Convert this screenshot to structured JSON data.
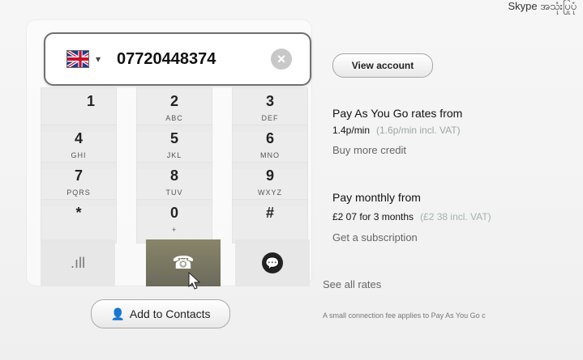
{
  "top_caption": "Skype အသုံးပြုပုံ",
  "dialer": {
    "country": "United Kingdom",
    "phone_number": "07720448374",
    "clear_label": "×",
    "keys": [
      {
        "num": "1",
        "sub": ""
      },
      {
        "num": "2",
        "sub": "ABC"
      },
      {
        "num": "3",
        "sub": "DEF"
      },
      {
        "num": "4",
        "sub": "GHI"
      },
      {
        "num": "5",
        "sub": "JKL"
      },
      {
        "num": "6",
        "sub": "MNO"
      },
      {
        "num": "7",
        "sub": "PQRS"
      },
      {
        "num": "8",
        "sub": "TUV"
      },
      {
        "num": "9",
        "sub": "WXYZ"
      },
      {
        "num": "*",
        "sub": ""
      },
      {
        "num": "0",
        "sub": "+"
      },
      {
        "num": "#",
        "sub": ""
      }
    ],
    "signal_label": ".ıll",
    "call_icon": "phone-icon",
    "chat_icon": "chat-icon",
    "add_to_contacts_label": "Add to Contacts"
  },
  "account": {
    "view_account_label": "View account",
    "payg_title": "Pay As You Go rates from",
    "payg_price": "1.4p/min",
    "payg_incl": "(1.6p/min incl. VAT)",
    "buy_more_credit": "Buy more credit",
    "monthly_title": "Pay monthly from",
    "monthly_price": "£2 07 for 3 months",
    "monthly_incl": "(£2 38 incl. VAT)",
    "get_subscription": "Get a subscription",
    "see_all_rates": "See all rates",
    "fee_note": "A small connection fee applies to Pay As You Go c"
  },
  "colors": {
    "call_button": "#7b7865",
    "muted_text": "#666666",
    "vat_text": "#9aa7a0"
  }
}
